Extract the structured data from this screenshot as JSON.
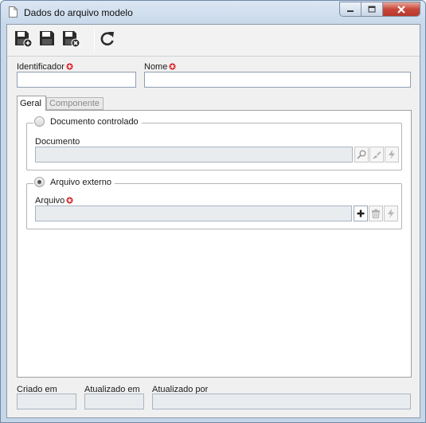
{
  "window": {
    "title": "Dados do arquivo modelo",
    "icon": "document-icon",
    "controls": [
      "minimize-icon",
      "maximize-icon",
      "close-icon"
    ]
  },
  "toolbar": {
    "buttons": [
      {
        "name": "save-new-button",
        "icon": "floppy-plus-icon"
      },
      {
        "name": "save-button",
        "icon": "floppy-icon"
      },
      {
        "name": "save-close-button",
        "icon": "floppy-close-icon"
      },
      {
        "name": "refresh-button",
        "icon": "refresh-icon"
      }
    ]
  },
  "form": {
    "identificador_label": "Identificador",
    "identificador_value": "",
    "nome_label": "Nome",
    "nome_value": "",
    "required_icon": "required-asterisk-icon",
    "required_color": "#d9262b"
  },
  "tabs": {
    "items": [
      {
        "label": "Geral",
        "active": true
      },
      {
        "label": "Componente",
        "active": false
      }
    ]
  },
  "geral": {
    "controlled": {
      "option_label": "Documento controlado",
      "selected": false,
      "field_label": "Documento",
      "field_value": "",
      "actions": [
        "search-icon",
        "eraser-icon",
        "lightning-icon"
      ]
    },
    "external": {
      "option_label": "Arquivo externo",
      "selected": true,
      "field_label": "Arquivo",
      "field_value": "",
      "actions": [
        "plus-icon",
        "trash-icon",
        "lightning-icon"
      ]
    }
  },
  "footer": {
    "created_label": "Criado em",
    "created_value": "",
    "updated_label": "Atualizado em",
    "updated_value": "",
    "updated_by_label": "Atualizado por",
    "updated_by_value": ""
  }
}
